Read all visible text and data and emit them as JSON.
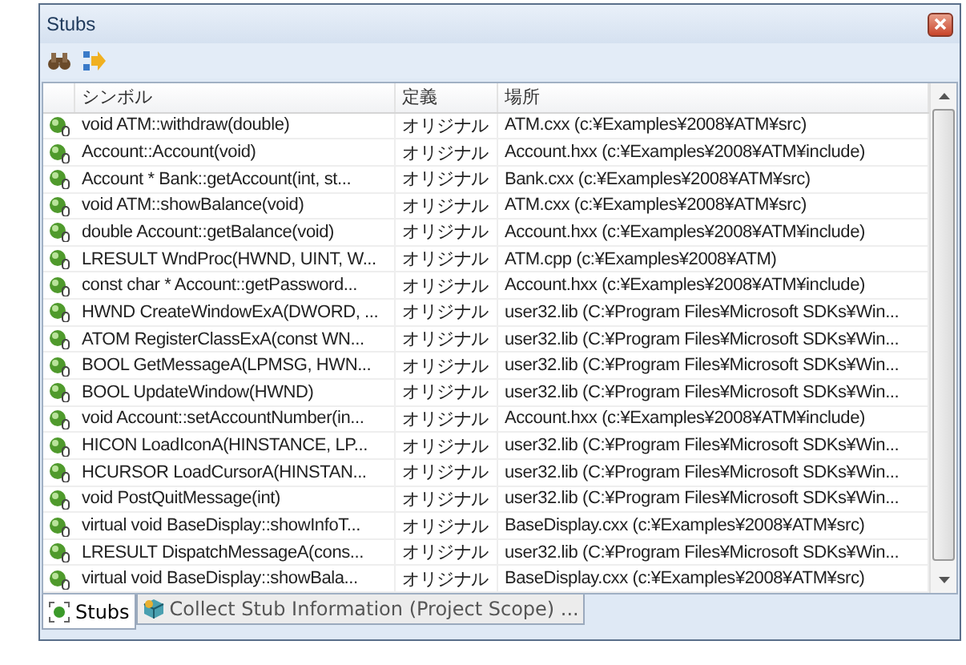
{
  "window": {
    "title": "Stubs"
  },
  "table": {
    "columns": [
      "シンボル",
      "定義",
      "場所"
    ],
    "rows": [
      {
        "symbol": "void ATM::withdraw(double)",
        "definition": "オリジナル",
        "location": "ATM.cxx  (c:¥Examples¥2008¥ATM¥src)"
      },
      {
        "symbol": "Account::Account(void)",
        "definition": "オリジナル",
        "location": "Account.hxx  (c:¥Examples¥2008¥ATM¥include)"
      },
      {
        "symbol": "Account * Bank::getAccount(int, st...",
        "definition": "オリジナル",
        "location": "Bank.cxx  (c:¥Examples¥2008¥ATM¥src)"
      },
      {
        "symbol": "void ATM::showBalance(void)",
        "definition": "オリジナル",
        "location": "ATM.cxx  (c:¥Examples¥2008¥ATM¥src)"
      },
      {
        "symbol": "double Account::getBalance(void)",
        "definition": "オリジナル",
        "location": "Account.hxx  (c:¥Examples¥2008¥ATM¥include)"
      },
      {
        "symbol": "LRESULT WndProc(HWND, UINT, W...",
        "definition": "オリジナル",
        "location": "ATM.cpp  (c:¥Examples¥2008¥ATM)"
      },
      {
        "symbol": "const char * Account::getPassword...",
        "definition": "オリジナル",
        "location": "Account.hxx  (c:¥Examples¥2008¥ATM¥include)"
      },
      {
        "symbol": "HWND CreateWindowExA(DWORD, ...",
        "definition": "オリジナル",
        "location": "user32.lib  (C:¥Program Files¥Microsoft SDKs¥Win..."
      },
      {
        "symbol": "ATOM RegisterClassExA(const WN...",
        "definition": "オリジナル",
        "location": "user32.lib  (C:¥Program Files¥Microsoft SDKs¥Win..."
      },
      {
        "symbol": "BOOL GetMessageA(LPMSG, HWN...",
        "definition": "オリジナル",
        "location": "user32.lib  (C:¥Program Files¥Microsoft SDKs¥Win..."
      },
      {
        "symbol": "BOOL UpdateWindow(HWND)",
        "definition": "オリジナル",
        "location": "user32.lib  (C:¥Program Files¥Microsoft SDKs¥Win..."
      },
      {
        "symbol": "void Account::setAccountNumber(in...",
        "definition": "オリジナル",
        "location": "Account.hxx  (c:¥Examples¥2008¥ATM¥include)"
      },
      {
        "symbol": "HICON LoadIconA(HINSTANCE, LP...",
        "definition": "オリジナル",
        "location": "user32.lib  (C:¥Program Files¥Microsoft SDKs¥Win..."
      },
      {
        "symbol": "HCURSOR LoadCursorA(HINSTAN...",
        "definition": "オリジナル",
        "location": "user32.lib  (C:¥Program Files¥Microsoft SDKs¥Win..."
      },
      {
        "symbol": "void PostQuitMessage(int)",
        "definition": "オリジナル",
        "location": "user32.lib  (C:¥Program Files¥Microsoft SDKs¥Win..."
      },
      {
        "symbol": "virtual void BaseDisplay::showInfoT...",
        "definition": "オリジナル",
        "location": "BaseDisplay.cxx  (c:¥Examples¥2008¥ATM¥src)"
      },
      {
        "symbol": "LRESULT DispatchMessageA(cons...",
        "definition": "オリジナル",
        "location": "user32.lib  (C:¥Program Files¥Microsoft SDKs¥Win..."
      },
      {
        "symbol": "virtual void BaseDisplay::showBala...",
        "definition": "オリジナル",
        "location": "BaseDisplay.cxx  (c:¥Examples¥2008¥ATM¥src)"
      }
    ]
  },
  "tabs": [
    {
      "label": "Stubs",
      "selected": true
    },
    {
      "label": "Collect Stub Information (Project Scope) ...",
      "selected": false
    }
  ]
}
